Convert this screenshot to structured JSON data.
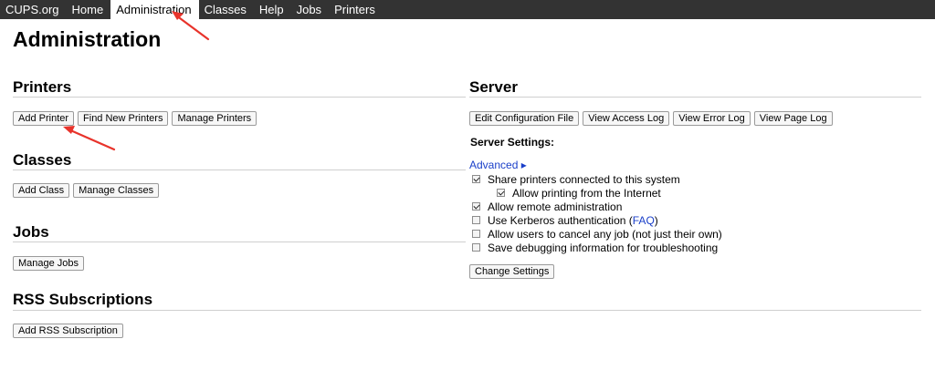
{
  "nav": {
    "items": [
      {
        "label": "CUPS.org",
        "active": false
      },
      {
        "label": "Home",
        "active": false
      },
      {
        "label": "Administration",
        "active": true
      },
      {
        "label": "Classes",
        "active": false
      },
      {
        "label": "Help",
        "active": false
      },
      {
        "label": "Jobs",
        "active": false
      },
      {
        "label": "Printers",
        "active": false
      }
    ]
  },
  "page": {
    "title": "Administration"
  },
  "printers": {
    "title": "Printers",
    "buttons": [
      "Add Printer",
      "Find New Printers",
      "Manage Printers"
    ]
  },
  "classes": {
    "title": "Classes",
    "buttons": [
      "Add Class",
      "Manage Classes"
    ]
  },
  "jobs": {
    "title": "Jobs",
    "buttons": [
      "Manage Jobs"
    ]
  },
  "rss": {
    "title": "RSS Subscriptions",
    "buttons": [
      "Add RSS Subscription"
    ]
  },
  "server": {
    "title": "Server",
    "buttons": [
      "Edit Configuration File",
      "View Access Log",
      "View Error Log",
      "View Page Log"
    ],
    "settings_label": "Server Settings:",
    "advanced_label": "Advanced ▸",
    "options": [
      {
        "label": "Share printers connected to this system",
        "checked": true
      },
      {
        "label": "Allow printing from the Internet",
        "checked": true
      },
      {
        "label": "Allow remote administration",
        "checked": true
      },
      {
        "label": "Use Kerberos authentication (",
        "link": "FAQ",
        "suffix": ")",
        "checked": false
      },
      {
        "label": "Allow users to cancel any job (not just their own)",
        "checked": false
      },
      {
        "label": "Save debugging information for troubleshooting",
        "checked": false
      }
    ],
    "change_settings_label": "Change Settings"
  },
  "annotation": {
    "arrow_color": "#e8332b"
  }
}
